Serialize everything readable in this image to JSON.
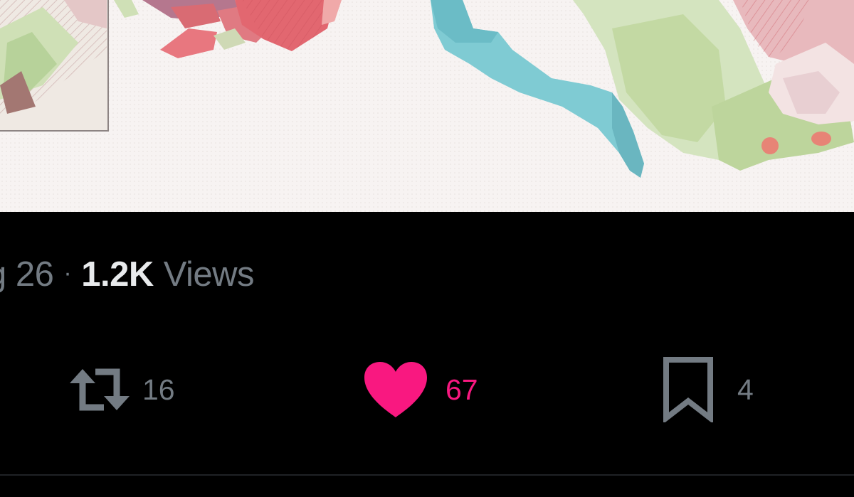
{
  "tweet": {
    "date_fragment": "g 26",
    "separator": "·",
    "views_count": "1.2K",
    "views_label": "Views"
  },
  "actions": {
    "retweet": {
      "icon": "retweet-icon",
      "count": "16",
      "color": "#737b83"
    },
    "like": {
      "icon": "heart-icon",
      "count": "67",
      "color": "#f91880",
      "active": true
    },
    "bookmark": {
      "icon": "bookmark-icon",
      "count": "4",
      "color": "#737b83"
    }
  },
  "colors": {
    "background": "#000000",
    "secondary_text": "#737b83",
    "primary_text": "#e8eaec",
    "like_accent": "#f91880",
    "divider": "#1f2226"
  }
}
